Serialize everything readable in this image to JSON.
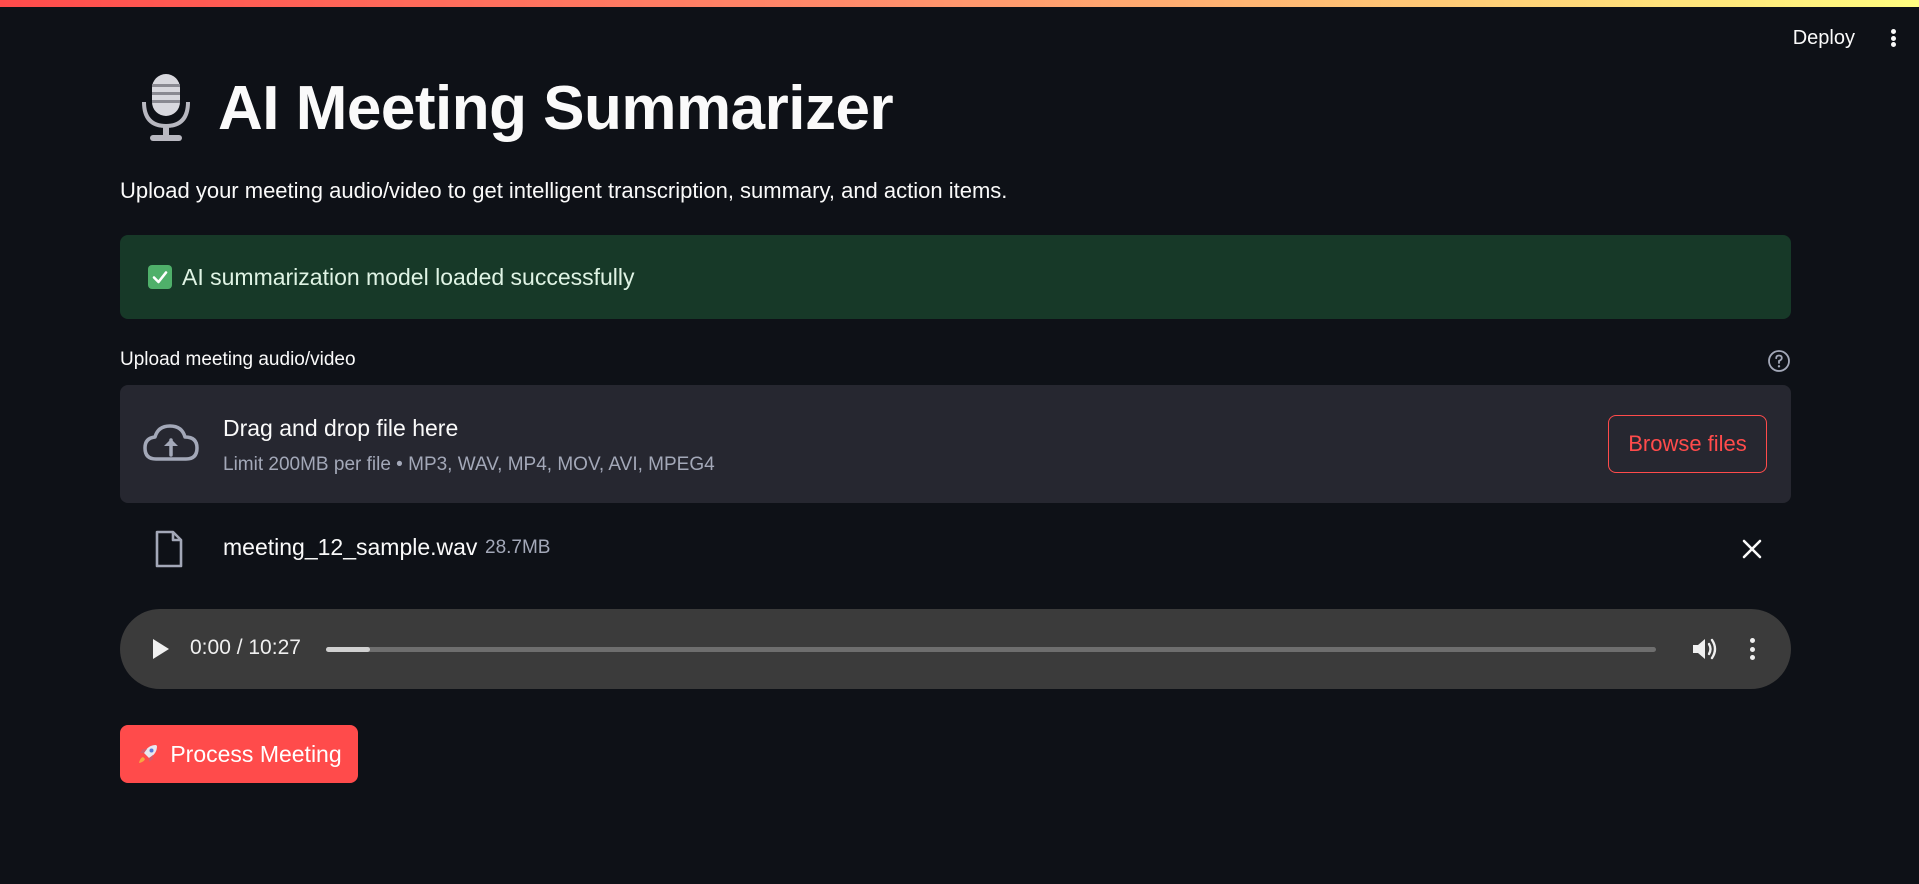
{
  "header": {
    "deploy_label": "Deploy"
  },
  "page": {
    "title": "AI Meeting Summarizer",
    "subtitle": "Upload your meeting audio/video to get intelligent transcription, summary, and action items."
  },
  "alert": {
    "message": "AI summarization model loaded successfully",
    "color": "#173928"
  },
  "uploader": {
    "label": "Upload meeting audio/video",
    "drop_title": "Drag and drop file here",
    "limit_text": "Limit 200MB per file • MP3, WAV, MP4, MOV, AVI, MPEG4",
    "browse_label": "Browse files"
  },
  "uploaded_file": {
    "name": "meeting_12_sample.wav",
    "size": "28.7MB"
  },
  "audio": {
    "time": "0:00 / 10:27",
    "progress_fraction": 0.033
  },
  "actions": {
    "process_label": "Process Meeting"
  },
  "colors": {
    "accent": "#ff4b4b",
    "background": "#0e1117",
    "secondary_bg": "#262730"
  },
  "icons": {
    "title": "microphone-icon",
    "alert": "check-box-icon",
    "help": "help-circle-icon",
    "upload": "cloud-upload-icon",
    "file": "file-icon",
    "remove": "close-icon",
    "play": "play-icon",
    "volume": "volume-icon",
    "process": "rocket-icon"
  }
}
